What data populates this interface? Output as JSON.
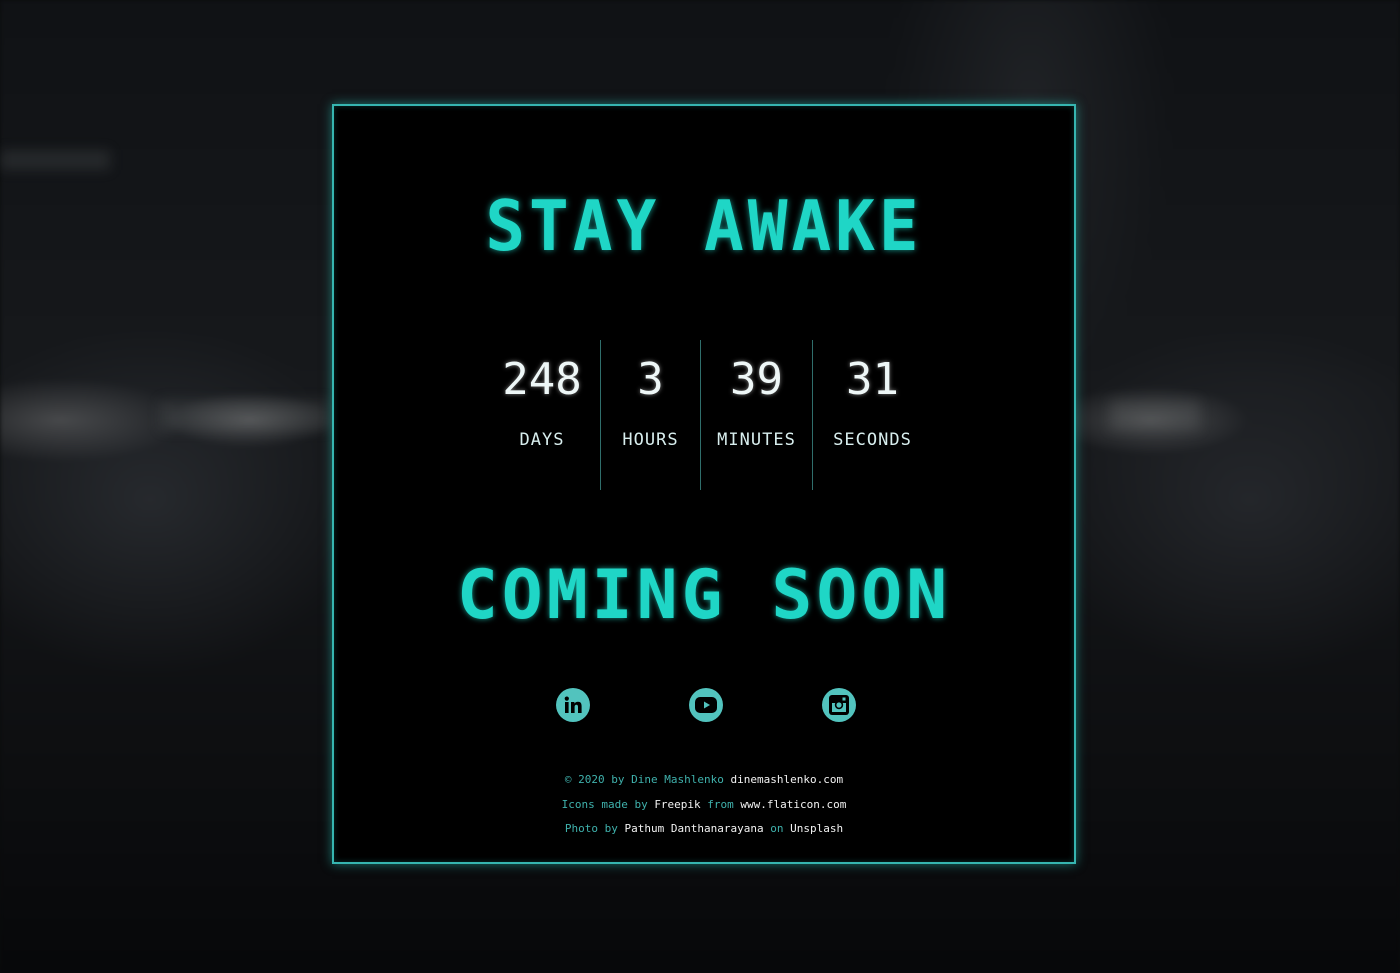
{
  "title": "STAY AWAKE",
  "countdown": {
    "days": {
      "value": "248",
      "label": "DAYS"
    },
    "hours": {
      "value": "3",
      "label": "HOURS"
    },
    "minutes": {
      "value": "39",
      "label": "MINUTES"
    },
    "seconds": {
      "value": "31",
      "label": "SECONDS"
    }
  },
  "subtitle": "COMING SOON",
  "social": [
    {
      "icon": "linkedin-icon"
    },
    {
      "icon": "youtube-icon"
    },
    {
      "icon": "instagram-icon"
    }
  ],
  "credits": {
    "line1": {
      "text": "© 2020 by Dine Mashlenko",
      "link": "dinemashlenko.com"
    },
    "line2": {
      "prefix": "Icons made by",
      "author": "Freepik",
      "from": "from",
      "site": "www.flaticon.com"
    },
    "line3": {
      "prefix": "Photo by",
      "author": "Pathum Danthanarayana",
      "on": "on",
      "site": "Unsplash"
    }
  },
  "colors": {
    "accent": "#1fd6c6",
    "border": "#36b5b0",
    "icon": "#52c3be",
    "background": "#000000"
  }
}
